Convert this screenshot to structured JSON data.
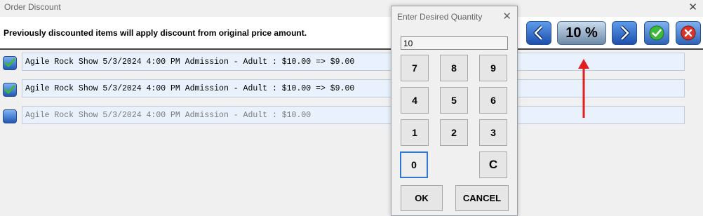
{
  "window": {
    "title": "Order Discount",
    "close_glyph": "✕"
  },
  "banner": {
    "message": "Previously discounted items will apply discount from original price amount."
  },
  "toolbar": {
    "prev_icon": "chevron-left-icon",
    "discount_label": "10 %",
    "next_icon": "chevron-right-icon",
    "confirm_icon": "check-circle-icon",
    "cancel_icon": "close-circle-icon"
  },
  "items": [
    {
      "checked": true,
      "text": "Agile Rock Show 5/3/2024 4:00 PM Admission - Adult : $10.00 => $9.00"
    },
    {
      "checked": true,
      "text": "Agile Rock Show 5/3/2024 4:00 PM Admission - Adult : $10.00 => $9.00"
    },
    {
      "checked": false,
      "text": "Agile Rock Show 5/3/2024 4:00 PM Admission - Adult : $10.00"
    }
  ],
  "keypad": {
    "title": "Enter Desired Quantity",
    "close_glyph": "✕",
    "value": "10",
    "keys": [
      "7",
      "8",
      "9",
      "4",
      "5",
      "6",
      "1",
      "2",
      "3",
      "0",
      "C"
    ],
    "ok_label": "OK",
    "cancel_label": "CANCEL"
  },
  "annotation": {
    "color": "#e02020"
  },
  "colors": {
    "accent_blue": "#1d4fae",
    "check_green": "#3dba3d",
    "cancel_red": "#d9342b"
  }
}
